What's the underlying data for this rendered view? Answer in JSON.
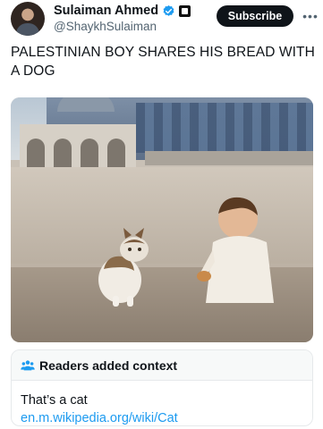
{
  "tweet": {
    "author_name": "Sulaiman Ahmed",
    "handle": "@ShaykhSulaiman",
    "subscribe_label": "Subscribe",
    "text": "PALESTINIAN BOY SHARES HIS BREAD WITH A DOG"
  },
  "context": {
    "title": "Readers added context",
    "body": "That’s a cat",
    "link": "en.m.wikipedia.org/wiki/Cat"
  },
  "icons": {
    "verified": "verified-badge-icon",
    "affiliation": "affiliation-badge-icon",
    "more": "more-dots-icon",
    "readers": "readers-people-icon"
  },
  "colors": {
    "text": "#0f1419",
    "secondary": "#536471",
    "link": "#1d9bf0",
    "verified": "#1d9bf0",
    "button_bg": "#0f1419"
  }
}
